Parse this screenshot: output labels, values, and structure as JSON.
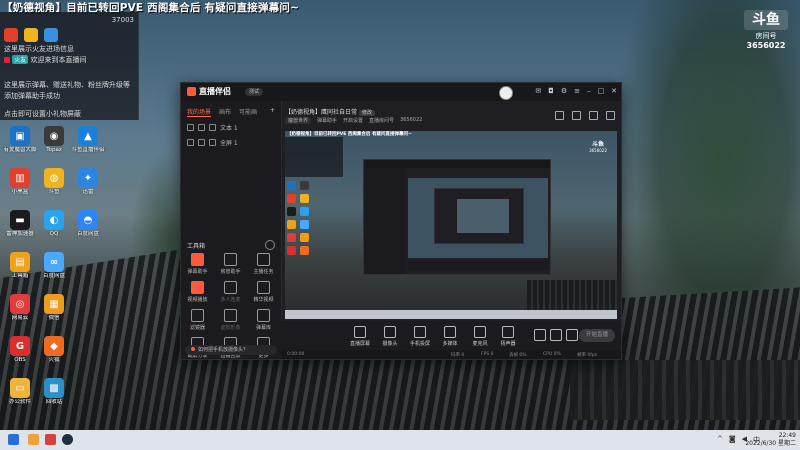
{
  "stream_title": "【奶德视角】目前已转回PVE 西阁集合后 有疑问直接弹幕问~",
  "overlay": {
    "line1": "这里展示火友进场信息",
    "line2_badge": "火友",
    "line2_text": "欢迎来到本直播间",
    "line3": "这里展示弹幕、赠送礼物、粉丝牌升级等",
    "line4": "添加弹幕助手成功",
    "line5": "点击即可设置小礼物屏蔽",
    "top_count": "37003"
  },
  "room_logo": {
    "mark": "斗鱼",
    "label": "房间号",
    "number": "3656022"
  },
  "desktop_icons": [
    {
      "label": "有爱魔兽大脚",
      "color": "#1d72c4",
      "glyph": "▣"
    },
    {
      "label": "Topaz",
      "color": "#3a3a3a",
      "glyph": "◉"
    },
    {
      "label": "斗鱼直播伴侣",
      "color": "#1e7fd8",
      "glyph": "▲"
    },
    {
      "label": "小黑盒",
      "color": "#e0402c",
      "glyph": "▥"
    },
    {
      "label": "斗鱼",
      "color": "#f0b21e",
      "glyph": "◍"
    },
    {
      "label": "迅雷",
      "color": "#2c85e0",
      "glyph": "✦"
    },
    {
      "label": "雷神加速器",
      "color": "#1b1b1b",
      "glyph": "▬"
    },
    {
      "label": "QQ",
      "color": "#2aa2ee",
      "glyph": "◐"
    },
    {
      "label": "百度网盘",
      "color": "#2f86f3",
      "glyph": "◓"
    },
    {
      "label": "工具箱",
      "color": "#f0a21a",
      "glyph": "▤"
    },
    {
      "label": "百度网盘",
      "color": "#4aa8ff",
      "glyph": "∞"
    },
    {
      "label": "网易云",
      "color": "#e13b3b",
      "glyph": "◎"
    },
    {
      "label": "微信",
      "color": "#f09a20",
      "glyph": "▦"
    },
    {
      "label": "OBS",
      "color": "#dd2e2e",
      "glyph": "G"
    },
    {
      "label": "火狐",
      "color": "#ef6b21",
      "glyph": "◆"
    },
    {
      "label": "办公软件",
      "color": "#f0b43c",
      "glyph": "▭"
    },
    {
      "label": "回收站",
      "color": "#2b8fc9",
      "glyph": "▩"
    }
  ],
  "app": {
    "logo_text": "直播伴侣",
    "version": "测试",
    "tabs": [
      "我的场景",
      "画布",
      "可能画"
    ],
    "tab_add": "+",
    "scenes": [
      "文本 1",
      "全屏 1"
    ],
    "tools_title": "工具箱",
    "tools": [
      {
        "label": "弹幕助手"
      },
      {
        "label": "房管助手"
      },
      {
        "label": "主播任务"
      },
      {
        "label": "视频播放"
      },
      {
        "label": "多人连麦"
      },
      {
        "label": "精华视频"
      },
      {
        "label": "滤镜器"
      },
      {
        "label": "虚拟形象"
      },
      {
        "label": "弹幕库"
      },
      {
        "label": "截屏分享"
      },
      {
        "label": "直播回放"
      },
      {
        "label": "更多"
      }
    ],
    "camera_question": "如何把手机放摄像头？",
    "room_name": "【奶德视角】鹰同社自日常",
    "room_tag": "修改",
    "room_meta": [
      "魔兽世界",
      "弹幕助手",
      "开启设置",
      "直播房间号",
      "3656022"
    ],
    "controls": [
      {
        "label": "直播屏幕"
      },
      {
        "label": "摄像头"
      },
      {
        "label": "手机投屏"
      },
      {
        "label": "多媒体"
      },
      {
        "label": "麦克风"
      },
      {
        "label": "扬声器"
      }
    ],
    "start_button": "开始直播",
    "status": [
      "0:00:00",
      "码率 0",
      "FPS 0",
      "丢帧 0%",
      "CPU 0%",
      "帧率 0fps"
    ]
  },
  "preview": {
    "title": "【奶德视角】目前已转回PVE 西阁集合后 有疑问直接弹幕问~",
    "logo": "斗鱼",
    "logo_num": "3656022"
  },
  "taskbar": {
    "time": "22:49",
    "date": "2022/6/30 星期二"
  }
}
